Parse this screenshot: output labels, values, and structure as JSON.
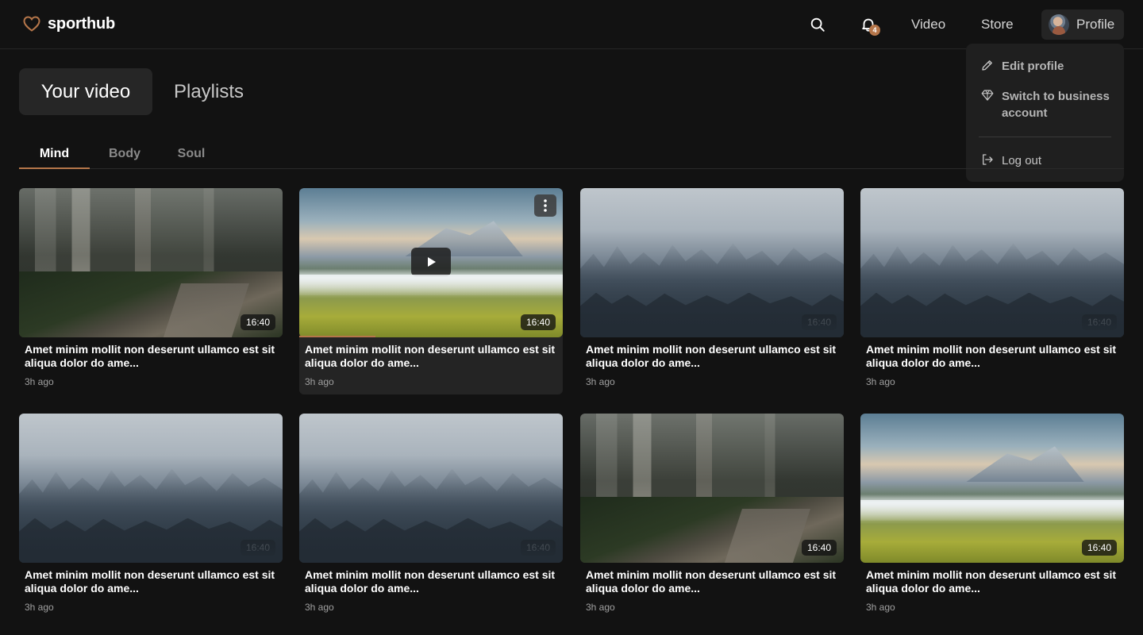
{
  "brand": {
    "name": "sporthub",
    "accent": "#b5764a",
    "logo_icon": "heart-icon"
  },
  "header": {
    "search_icon": "search-icon",
    "notifications": {
      "icon": "bell-icon",
      "count": "4"
    },
    "nav": [
      {
        "label": "Video"
      },
      {
        "label": "Store"
      }
    ],
    "profile": {
      "label": "Profile",
      "avatar": "user-avatar"
    }
  },
  "profile_menu": {
    "items": [
      {
        "label": "Edit profile",
        "icon": "pencil-icon"
      },
      {
        "label": "Switch to business account",
        "icon": "diamond-icon"
      },
      {
        "label": "Log out",
        "icon": "logout-icon"
      }
    ]
  },
  "primary_tabs": [
    {
      "label": "Your video",
      "active": true
    },
    {
      "label": "Playlists",
      "active": false
    }
  ],
  "secondary_tabs": [
    {
      "label": "Mind",
      "active": true
    },
    {
      "label": "Body",
      "active": false
    },
    {
      "label": "Soul",
      "active": false
    }
  ],
  "videos": [
    {
      "title": "Amet minim mollit non deserunt ullamco est sit aliqua dolor do ame...",
      "time": "3h ago",
      "duration": "16:40",
      "scene": "forest"
    },
    {
      "title": "Amet minim mollit non deserunt ullamco est sit aliqua dolor do ame...",
      "time": "3h ago",
      "duration": "16:40",
      "scene": "valley",
      "hovered": true,
      "progress": 0.29
    },
    {
      "title": "Amet minim mollit non deserunt ullamco est sit aliqua dolor do ame...",
      "time": "3h ago",
      "duration": "16:40",
      "scene": "fog"
    },
    {
      "title": "Amet minim mollit non deserunt ullamco est sit aliqua dolor do ame...",
      "time": "3h ago",
      "duration": "16:40",
      "scene": "fog"
    },
    {
      "title": "Amet minim mollit non deserunt ullamco est sit aliqua dolor do ame...",
      "time": "3h ago",
      "duration": "16:40",
      "scene": "fog"
    },
    {
      "title": "Amet minim mollit non deserunt ullamco est sit aliqua dolor do ame...",
      "time": "3h ago",
      "duration": "16:40",
      "scene": "fog"
    },
    {
      "title": "Amet minim mollit non deserunt ullamco est sit aliqua dolor do ame...",
      "time": "3h ago",
      "duration": "16:40",
      "scene": "forest"
    },
    {
      "title": "Amet minim mollit non deserunt ullamco est sit aliqua dolor do ame...",
      "time": "3h ago",
      "duration": "16:40",
      "scene": "valley"
    }
  ]
}
